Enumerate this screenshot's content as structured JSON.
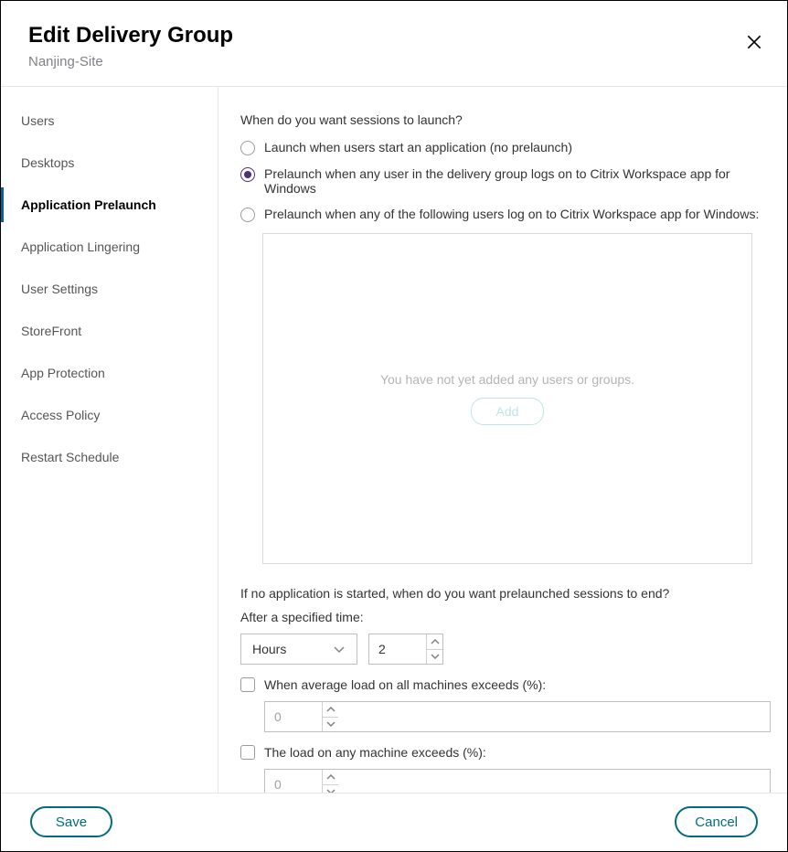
{
  "header": {
    "title": "Edit Delivery Group",
    "subtitle": "Nanjing-Site"
  },
  "sidebar": {
    "items": [
      {
        "label": "Users",
        "active": false
      },
      {
        "label": "Desktops",
        "active": false
      },
      {
        "label": "Application Prelaunch",
        "active": true
      },
      {
        "label": "Application Lingering",
        "active": false
      },
      {
        "label": "User Settings",
        "active": false
      },
      {
        "label": "StoreFront",
        "active": false
      },
      {
        "label": "App Protection",
        "active": false
      },
      {
        "label": "Access Policy",
        "active": false
      },
      {
        "label": "Restart Schedule",
        "active": false
      }
    ]
  },
  "main": {
    "question": "When do you want sessions to launch?",
    "options": [
      {
        "label": "Launch when users start an application (no prelaunch)",
        "selected": false
      },
      {
        "label": "Prelaunch when any user in the delivery group logs on to Citrix Workspace app for Windows",
        "selected": true
      },
      {
        "label": "Prelaunch when any of the following users log on to Citrix Workspace app for Windows:",
        "selected": false
      }
    ],
    "users_empty": "You have not yet added any users or groups.",
    "add_label": "Add",
    "end_question": "If no application is started, when do you want prelaunched sessions to end?",
    "after_time_label": "After a specified time:",
    "time_unit": "Hours",
    "time_value": "2",
    "avg_load_label": "When average load on all machines exceeds (%):",
    "avg_load_value": "0",
    "any_load_label": "The load on any machine exceeds (%):",
    "any_load_value": "0"
  },
  "footer": {
    "save": "Save",
    "cancel": "Cancel"
  }
}
